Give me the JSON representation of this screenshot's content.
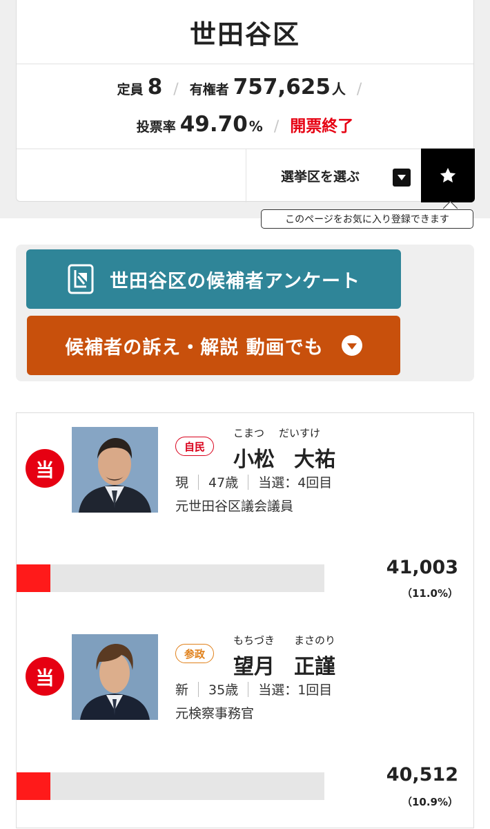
{
  "district": {
    "name": "世田谷区",
    "seats_label": "定員",
    "seats": "8",
    "voters_label": "有権者",
    "voters": "757,625",
    "voters_unit": "人",
    "turnout_label": "投票率",
    "turnout": "49.70",
    "turnout_unit": "%",
    "count_status": "開票終了",
    "separator": "/"
  },
  "actions": {
    "select_district_label": "選挙区を選ぶ",
    "favorite_tooltip": "このページをお気に入り登録できます"
  },
  "links": {
    "survey_label": "世田谷区の候補者アンケート",
    "video_label": "候補者の訴え・解説 動画でも"
  },
  "candidates": [
    {
      "result": "当",
      "party": "自民",
      "kana_family": "こまつ",
      "kana_given": "だいすけ",
      "name_family": "小松",
      "name_given": "大祐",
      "status": "現",
      "age": "47歳",
      "elected_count": "当選：4回目",
      "career": "元世田谷区議会議員",
      "votes": "41,003",
      "share": "（11.0%）",
      "share_value": 11.0
    },
    {
      "result": "当",
      "party": "参政",
      "kana_family": "もちづき",
      "kana_given": "まさのり",
      "name_family": "望月",
      "name_given": "正謹",
      "status": "新",
      "age": "35歳",
      "elected_count": "当選：1回目",
      "career": "元検察事務官",
      "votes": "40,512",
      "share": "（10.9%）",
      "share_value": 10.9
    }
  ],
  "colors": {
    "accent_red": "#e60012",
    "survey_button": "#2f8598",
    "video_button": "#c8500c",
    "party_ldp": "#d9001b",
    "party_sanseito": "#e0801a",
    "bar_fill": "#ff1a1a"
  },
  "icons": {
    "favorite": "star-icon",
    "select": "dropdown-triangle-icon",
    "survey": "survey-document-icon",
    "video": "expand-circle-icon"
  }
}
